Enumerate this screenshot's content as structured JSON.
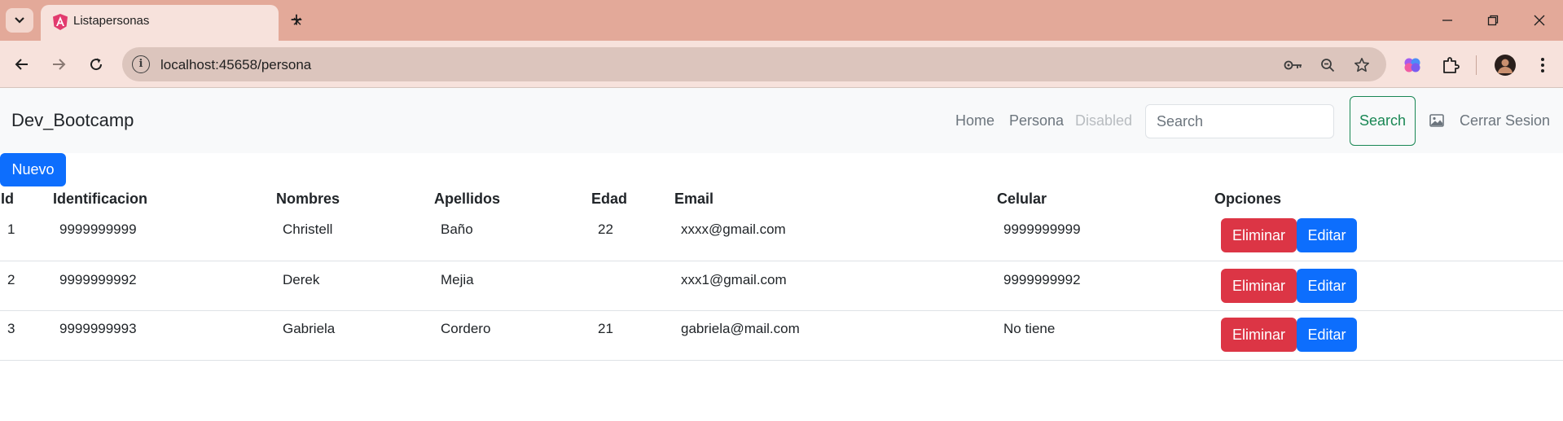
{
  "browser": {
    "tab_title": "Listapersonas",
    "url": "localhost:45658/persona"
  },
  "navbar": {
    "brand": "Dev_Bootcamp",
    "links": [
      "Home",
      "Persona",
      "Disabled"
    ],
    "search_placeholder": "Search",
    "search_button": "Search",
    "logout": "Cerrar Sesion"
  },
  "new_button": "Nuevo",
  "table": {
    "headers": [
      "Id",
      "Identificacion",
      "Nombres",
      "Apellidos",
      "Edad",
      "Email",
      "Celular",
      "Opciones"
    ],
    "rows": [
      [
        "1",
        "9999999999",
        "Christell",
        "Baño",
        "22",
        "xxxx@gmail.com",
        "9999999999"
      ],
      [
        "2",
        "9999999992",
        "Derek",
        "Mejia",
        "",
        "xxx1@gmail.com",
        "9999999992"
      ],
      [
        "3",
        "9999999993",
        "Gabriela",
        "Cordero",
        "21",
        "gabriela@mail.com",
        "No tiene"
      ]
    ],
    "delete_label": "Eliminar",
    "edit_label": "Editar"
  },
  "colors": {
    "primary": "#0d6efd",
    "danger": "#dc3545",
    "success": "#198754",
    "chrome_frame": "#e3a999",
    "chrome_toolbar": "#f7e2dc"
  },
  "icons": [
    "tab-search-icon",
    "angular-favicon-icon",
    "close-icon",
    "plus-icon",
    "minimize-icon",
    "restore-icon",
    "back-icon",
    "forward-icon",
    "reload-icon",
    "site-info-icon",
    "password-key-icon",
    "zoom-icon",
    "star-icon",
    "ai-extension-icon",
    "puzzle-icon",
    "avatar",
    "kebab-menu-icon",
    "image-icon"
  ]
}
